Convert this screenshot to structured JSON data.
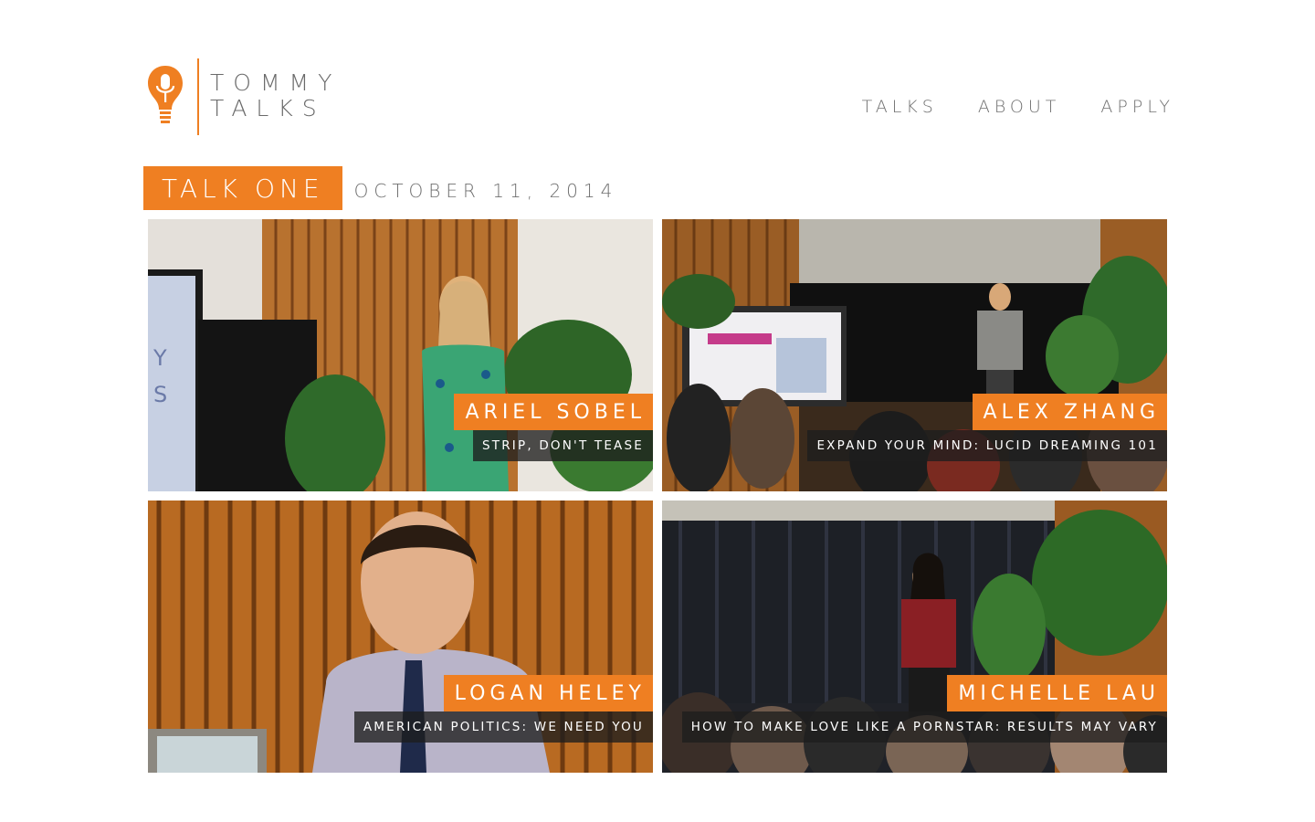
{
  "brand": {
    "line1": "TOMMY",
    "line2": "TALKS",
    "accent_color": "#ef7f22"
  },
  "nav": {
    "items": [
      "TALKS",
      "ABOUT",
      "APPLY"
    ]
  },
  "section": {
    "label": "TALK ONE",
    "date": "OCTOBER 11, 2014"
  },
  "talks": [
    {
      "speaker": "ARIEL SOBEL",
      "title": "STRIP, DON'T TEASE"
    },
    {
      "speaker": "ALEX ZHANG",
      "title": "EXPAND YOUR MIND: LUCID DREAMING 101"
    },
    {
      "speaker": "LOGAN HELEY",
      "title": "AMERICAN POLITICS: WE NEED YOU"
    },
    {
      "speaker": "MICHELLE LAU",
      "title": "HOW TO MAKE LOVE LIKE A PORNSTAR: RESULTS MAY VARY"
    }
  ]
}
